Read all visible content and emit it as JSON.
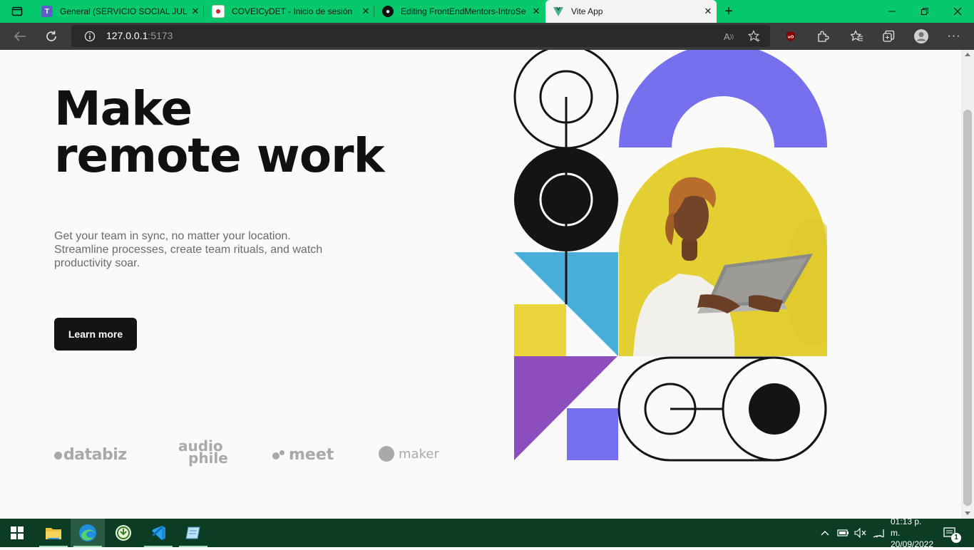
{
  "browser": {
    "tabs": [
      {
        "title": "General (SERVICIO SOCIAL JULIO",
        "favicon": "teams-icon",
        "favicon_color": "#5b5fc7"
      },
      {
        "title": "COVEICyDET - Inicio de sesión",
        "favicon": "flag-icon",
        "favicon_color": "#ffffff"
      },
      {
        "title": "Editing FrontEndMentors-IntroSe",
        "favicon": "github-icon",
        "favicon_color": "#111111"
      },
      {
        "title": "Vite App",
        "favicon": "vite-icon",
        "favicon_color": "#41b883"
      }
    ],
    "address": {
      "host": "127.0.0.1",
      "port": ":5173"
    },
    "accent": "#05c86a"
  },
  "hero": {
    "title_line1": "Make",
    "title_line2": "remote work",
    "description": "Get your team in sync, no matter your location. Streamline processes, create team rituals, and watch productivity soar.",
    "cta_label": "Learn more"
  },
  "clients": [
    {
      "name": "databiz"
    },
    {
      "name": "audio",
      "name2": "phile"
    },
    {
      "name": "meet"
    },
    {
      "name": "maker"
    }
  ],
  "colors": {
    "black": "#141414",
    "purple_blue": "#7670ef",
    "yellow": "#ebd53c",
    "sky": "#4aaedb",
    "violet": "#8c4dbd",
    "photo_bg": "#e4cf32"
  },
  "taskbar": {
    "time": "01:13 p. m.",
    "date": "20/09/2022",
    "notification_count": "1"
  }
}
